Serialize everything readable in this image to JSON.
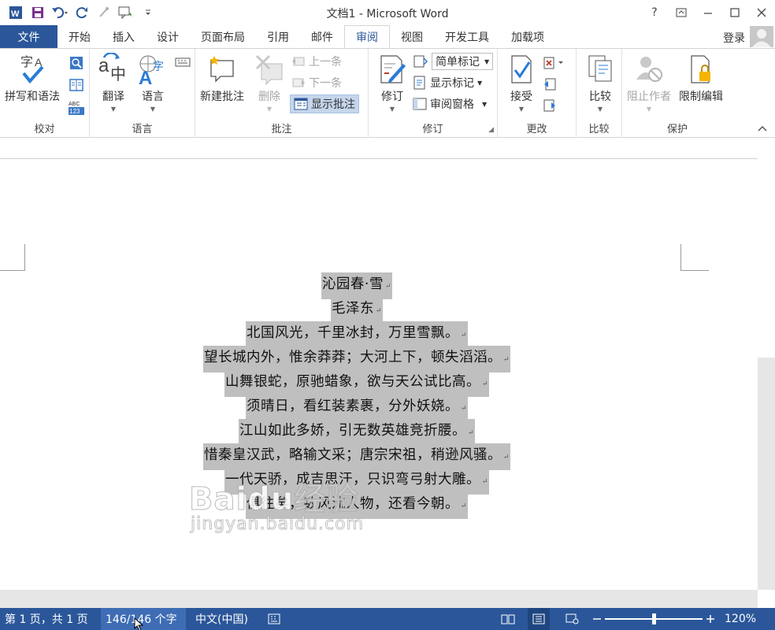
{
  "app": {
    "title": "文档1 - Microsoft Word",
    "help": "?",
    "brand_color": "#2b579a"
  },
  "tabs": {
    "file": "文件",
    "items": [
      "开始",
      "插入",
      "设计",
      "页面布局",
      "引用",
      "邮件",
      "审阅",
      "视图",
      "开发工具",
      "加载项"
    ],
    "active": "审阅",
    "login": "登录"
  },
  "ribbon": {
    "proofing": {
      "label": "校对",
      "spelling": "拼写和语法"
    },
    "language": {
      "label": "语言",
      "translate": "翻译",
      "language": "语言"
    },
    "comments": {
      "label": "批注",
      "new": "新建批注",
      "delete": "删除",
      "previous": "上一条",
      "next": "下一条",
      "show": "显示批注"
    },
    "tracking": {
      "label": "修订",
      "track": "修订",
      "simple_markup": "简单标记",
      "show_markup": "显示标记",
      "reviewing_pane": "审阅窗格"
    },
    "changes": {
      "label": "更改",
      "accept": "接受"
    },
    "compare": {
      "label": "比较",
      "compare": "比较"
    },
    "protect": {
      "label": "保护",
      "block_authors": "阻止作者",
      "restrict_editing": "限制编辑"
    }
  },
  "document": {
    "lines": [
      "沁园春·雪",
      "毛泽东",
      "北国风光，千里冰封，万里雪飘。",
      "望长城内外，惟余莽莽；大河上下，顿失滔滔。",
      "山舞银蛇，原驰蜡象，欲与天公试比高。",
      "须晴日，看红装素裹，分外妖娆。",
      "江山如此多娇，引无数英雄竞折腰。",
      "惜秦皇汉武，略输文采；唐宗宋祖，稍逊风骚。",
      "一代天骄，成吉思汗，只识弯弓射大雕。",
      "俱往矣，数风流人物，还看今朝。"
    ],
    "paragraph_mark": "↵",
    "watermark": {
      "brand": "Baidu经验",
      "url": "jingyan.baidu.com"
    }
  },
  "status": {
    "page": "第 1 页，共 1 页",
    "words": "146/146 个字",
    "language": "中文(中国)",
    "zoom": "120%",
    "zoom_fraction": 0.5
  }
}
